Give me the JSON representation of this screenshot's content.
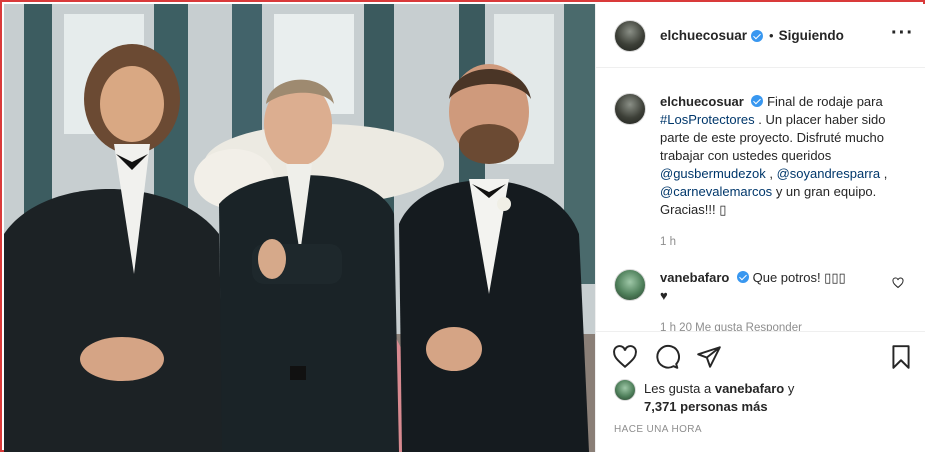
{
  "post": {
    "author": "elchuecosuar",
    "follow_status": "Siguiendo",
    "more_icon": "more-dots-icon"
  },
  "caption": {
    "username": "elchuecosuar",
    "text_1": "Final de rodaje para",
    "hashtag": "#LosProtectores",
    "text_2": ". Un placer haber sido parte de este proyecto. Disfruté mucho trabajar con ustedes queridos",
    "mention_1": "@gusbermudezok",
    "sep_1": " ,",
    "mention_2": "@soyandresparra",
    "sep_2": " ,",
    "mention_3": "@carnevalemarcos",
    "text_3": "y un gran equipo. Gracias!!! ",
    "emoji": "▯",
    "time": "1 h"
  },
  "comment": {
    "username": "vanebafaro",
    "text": "Que potros! ▯▯▯",
    "heart": "♥",
    "meta": "1 h   20 Me gusta   Responder"
  },
  "likes": {
    "prefix": "Les gusta a",
    "user": "vanebafaro",
    "suffix": "y",
    "count": "7,371 personas más"
  },
  "timestamp": "HACE UNA HORA",
  "colors": {
    "border": "#d93a3a",
    "link": "#00376b",
    "verified": "#3897f0",
    "muted": "#8e8e8e"
  }
}
